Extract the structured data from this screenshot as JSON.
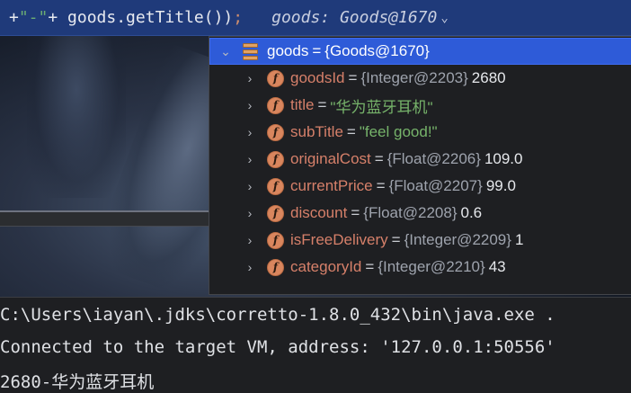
{
  "editor": {
    "code_line": {
      "part1": "+ ",
      "part2": "\"-\"",
      "part3": "+ goods.getTitle())",
      "semicolon": ";",
      "inline_value": "goods: Goods@1670",
      "chevron": "⌄"
    }
  },
  "debug_popup": {
    "root": {
      "toggle": "⌄",
      "name": "goods",
      "eq": "=",
      "value": "{Goods@1670}"
    },
    "fields": [
      {
        "name": "goodsId",
        "eq": "=",
        "ref": "{Integer@2203}",
        "value": "2680",
        "is_string": false
      },
      {
        "name": "title",
        "eq": "=",
        "ref": "",
        "value": "\"华为蓝牙耳机\"",
        "is_string": true
      },
      {
        "name": "subTitle",
        "eq": "=",
        "ref": "",
        "value": "\"feel good!\"",
        "is_string": true
      },
      {
        "name": "originalCost",
        "eq": "=",
        "ref": "{Float@2206}",
        "value": "109.0",
        "is_string": false
      },
      {
        "name": "currentPrice",
        "eq": "=",
        "ref": "{Float@2207}",
        "value": "99.0",
        "is_string": false
      },
      {
        "name": "discount",
        "eq": "=",
        "ref": "{Float@2208}",
        "value": "0.6",
        "is_string": false
      },
      {
        "name": "isFreeDelivery",
        "eq": "=",
        "ref": "{Integer@2209}",
        "value": "1",
        "is_string": false
      },
      {
        "name": "categoryId",
        "eq": "=",
        "ref": "{Integer@2210}",
        "value": "43",
        "is_string": false
      }
    ],
    "field_badge": "f",
    "expand_glyph": "›"
  },
  "console": {
    "lines": [
      "C:\\Users\\iayan\\.jdks\\corretto-1.8.0_432\\bin\\java.exe .",
      "Connected to the target VM, address: '127.0.0.1:50556'",
      "2680-华为蓝牙耳机"
    ]
  },
  "colors": {
    "selection": "#2e5bd8",
    "field_name": "#d6806a",
    "string_value": "#76b36a",
    "field_badge": "#d9865e"
  }
}
